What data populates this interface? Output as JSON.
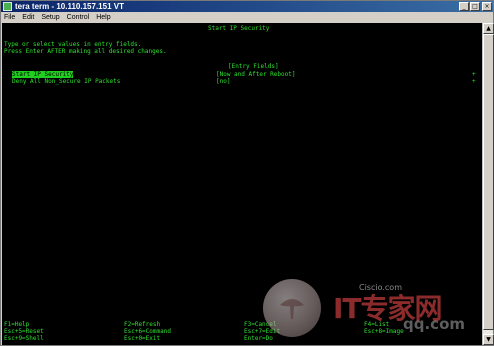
{
  "window": {
    "title": "tera term - 10.110.157.151 VT",
    "minimize": "_",
    "maximize": "□",
    "close": "×"
  },
  "menu": [
    "File",
    "Edit",
    "Setup",
    "Control",
    "Help"
  ],
  "terminal": {
    "screen_title": "Start IP Security",
    "instructions": [
      "Type or select values in entry fields.",
      "Press Enter AFTER making all desired changes."
    ],
    "entry_fields_header": "[Entry Fields]",
    "fields": [
      {
        "label": "Start IP Security",
        "value": "[Now and After Reboot]",
        "marker": "+",
        "selected": true
      },
      {
        "label": "Deny All Non_Secure IP Packets",
        "value": "[no]",
        "marker": "+",
        "selected": false
      }
    ],
    "function_keys": [
      [
        "F1=Help",
        "F2=Refresh",
        "F3=Cancel",
        "F4=List"
      ],
      [
        "Esc+5=Reset",
        "Esc+6=Command",
        "Esc+7=Edit",
        "Esc+8=Image"
      ],
      [
        "Esc+9=Shell",
        "Esc+0=Exit",
        "Enter=Do",
        ""
      ]
    ]
  },
  "watermark": {
    "brand": "IT专家网",
    "site": "Ciscio.com",
    "url": "qq.com"
  },
  "colors": {
    "terminal_bg": "#000000",
    "terminal_fg": "#2ee02e",
    "highlight_bg": "#1fd01f",
    "titlebar": "#0a246a"
  }
}
